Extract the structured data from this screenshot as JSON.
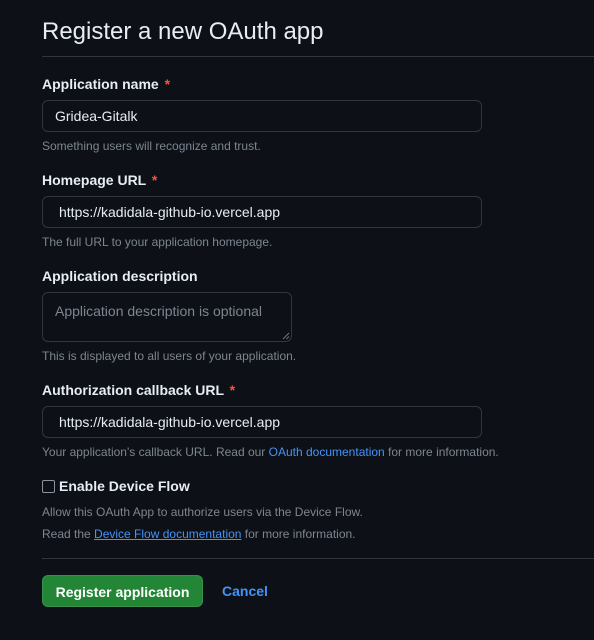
{
  "header": {
    "title": "Register a new OAuth app"
  },
  "fields": {
    "app_name": {
      "label": "Application name",
      "required_mark": "*",
      "value": "Gridea-Gitalk",
      "note": "Something users will recognize and trust."
    },
    "homepage_url": {
      "label": "Homepage URL",
      "required_mark": "*",
      "value": "https://kadidala-github-io.vercel.app",
      "note": "The full URL to your application homepage."
    },
    "description": {
      "label": "Application description",
      "placeholder": "Application description is optional",
      "note": "This is displayed to all users of your application."
    },
    "callback_url": {
      "label": "Authorization callback URL",
      "required_mark": "*",
      "value": "https://kadidala-github-io.vercel.app",
      "note_prefix": "Your application's callback URL. Read our ",
      "note_link": "OAuth documentation",
      "note_suffix": " for more information."
    }
  },
  "device_flow": {
    "label": "Enable Device Flow",
    "checked": false,
    "note_line1": "Allow this OAuth App to authorize users via the Device Flow.",
    "note_line2_prefix": "Read the ",
    "note_line2_link": "Device Flow documentation",
    "note_line2_suffix": " for more information."
  },
  "actions": {
    "register_label": "Register application",
    "cancel_label": "Cancel"
  },
  "colors": {
    "background": "#0d1117",
    "text": "#e6edf3",
    "muted": "#7d8590",
    "border": "#30363d",
    "link": "#4493f8",
    "required": "#f85149",
    "primary_button": "#238636"
  }
}
